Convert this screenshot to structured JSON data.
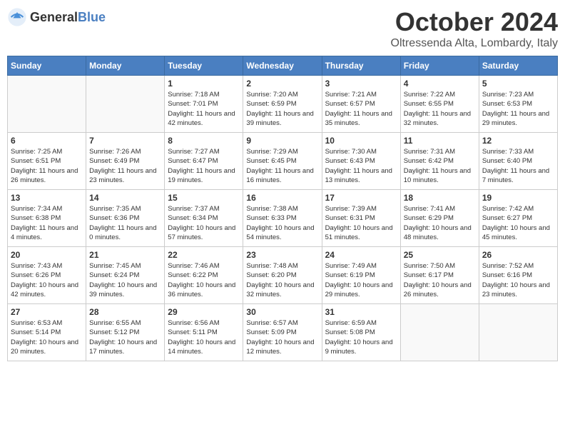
{
  "header": {
    "logo_general": "General",
    "logo_blue": "Blue",
    "month_year": "October 2024",
    "location": "Oltressenda Alta, Lombardy, Italy"
  },
  "weekdays": [
    "Sunday",
    "Monday",
    "Tuesday",
    "Wednesday",
    "Thursday",
    "Friday",
    "Saturday"
  ],
  "weeks": [
    [
      {
        "day": "",
        "info": ""
      },
      {
        "day": "",
        "info": ""
      },
      {
        "day": "1",
        "info": "Sunrise: 7:18 AM\nSunset: 7:01 PM\nDaylight: 11 hours and 42 minutes."
      },
      {
        "day": "2",
        "info": "Sunrise: 7:20 AM\nSunset: 6:59 PM\nDaylight: 11 hours and 39 minutes."
      },
      {
        "day": "3",
        "info": "Sunrise: 7:21 AM\nSunset: 6:57 PM\nDaylight: 11 hours and 35 minutes."
      },
      {
        "day": "4",
        "info": "Sunrise: 7:22 AM\nSunset: 6:55 PM\nDaylight: 11 hours and 32 minutes."
      },
      {
        "day": "5",
        "info": "Sunrise: 7:23 AM\nSunset: 6:53 PM\nDaylight: 11 hours and 29 minutes."
      }
    ],
    [
      {
        "day": "6",
        "info": "Sunrise: 7:25 AM\nSunset: 6:51 PM\nDaylight: 11 hours and 26 minutes."
      },
      {
        "day": "7",
        "info": "Sunrise: 7:26 AM\nSunset: 6:49 PM\nDaylight: 11 hours and 23 minutes."
      },
      {
        "day": "8",
        "info": "Sunrise: 7:27 AM\nSunset: 6:47 PM\nDaylight: 11 hours and 19 minutes."
      },
      {
        "day": "9",
        "info": "Sunrise: 7:29 AM\nSunset: 6:45 PM\nDaylight: 11 hours and 16 minutes."
      },
      {
        "day": "10",
        "info": "Sunrise: 7:30 AM\nSunset: 6:43 PM\nDaylight: 11 hours and 13 minutes."
      },
      {
        "day": "11",
        "info": "Sunrise: 7:31 AM\nSunset: 6:42 PM\nDaylight: 11 hours and 10 minutes."
      },
      {
        "day": "12",
        "info": "Sunrise: 7:33 AM\nSunset: 6:40 PM\nDaylight: 11 hours and 7 minutes."
      }
    ],
    [
      {
        "day": "13",
        "info": "Sunrise: 7:34 AM\nSunset: 6:38 PM\nDaylight: 11 hours and 4 minutes."
      },
      {
        "day": "14",
        "info": "Sunrise: 7:35 AM\nSunset: 6:36 PM\nDaylight: 11 hours and 0 minutes."
      },
      {
        "day": "15",
        "info": "Sunrise: 7:37 AM\nSunset: 6:34 PM\nDaylight: 10 hours and 57 minutes."
      },
      {
        "day": "16",
        "info": "Sunrise: 7:38 AM\nSunset: 6:33 PM\nDaylight: 10 hours and 54 minutes."
      },
      {
        "day": "17",
        "info": "Sunrise: 7:39 AM\nSunset: 6:31 PM\nDaylight: 10 hours and 51 minutes."
      },
      {
        "day": "18",
        "info": "Sunrise: 7:41 AM\nSunset: 6:29 PM\nDaylight: 10 hours and 48 minutes."
      },
      {
        "day": "19",
        "info": "Sunrise: 7:42 AM\nSunset: 6:27 PM\nDaylight: 10 hours and 45 minutes."
      }
    ],
    [
      {
        "day": "20",
        "info": "Sunrise: 7:43 AM\nSunset: 6:26 PM\nDaylight: 10 hours and 42 minutes."
      },
      {
        "day": "21",
        "info": "Sunrise: 7:45 AM\nSunset: 6:24 PM\nDaylight: 10 hours and 39 minutes."
      },
      {
        "day": "22",
        "info": "Sunrise: 7:46 AM\nSunset: 6:22 PM\nDaylight: 10 hours and 36 minutes."
      },
      {
        "day": "23",
        "info": "Sunrise: 7:48 AM\nSunset: 6:20 PM\nDaylight: 10 hours and 32 minutes."
      },
      {
        "day": "24",
        "info": "Sunrise: 7:49 AM\nSunset: 6:19 PM\nDaylight: 10 hours and 29 minutes."
      },
      {
        "day": "25",
        "info": "Sunrise: 7:50 AM\nSunset: 6:17 PM\nDaylight: 10 hours and 26 minutes."
      },
      {
        "day": "26",
        "info": "Sunrise: 7:52 AM\nSunset: 6:16 PM\nDaylight: 10 hours and 23 minutes."
      }
    ],
    [
      {
        "day": "27",
        "info": "Sunrise: 6:53 AM\nSunset: 5:14 PM\nDaylight: 10 hours and 20 minutes."
      },
      {
        "day": "28",
        "info": "Sunrise: 6:55 AM\nSunset: 5:12 PM\nDaylight: 10 hours and 17 minutes."
      },
      {
        "day": "29",
        "info": "Sunrise: 6:56 AM\nSunset: 5:11 PM\nDaylight: 10 hours and 14 minutes."
      },
      {
        "day": "30",
        "info": "Sunrise: 6:57 AM\nSunset: 5:09 PM\nDaylight: 10 hours and 12 minutes."
      },
      {
        "day": "31",
        "info": "Sunrise: 6:59 AM\nSunset: 5:08 PM\nDaylight: 10 hours and 9 minutes."
      },
      {
        "day": "",
        "info": ""
      },
      {
        "day": "",
        "info": ""
      }
    ]
  ]
}
